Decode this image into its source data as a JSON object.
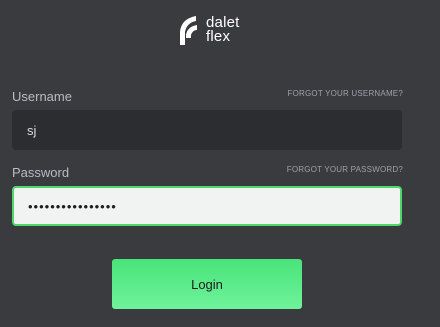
{
  "brand": {
    "line1": "dalet",
    "line2": "flex",
    "logo_icon": "dalet-flex-logo-icon",
    "color": "#ffffff"
  },
  "username": {
    "label": "Username",
    "forgot_link": "FORGOT YOUR USERNAME?",
    "value": "sj"
  },
  "password": {
    "label": "Password",
    "forgot_link": "FORGOT YOUR PASSWORD?",
    "value": "••••••••••••••••"
  },
  "login_button": {
    "label": "Login",
    "color": "#5aeb8a"
  },
  "colors": {
    "background": "#3a3b3f",
    "focus_border": "#4cd96a"
  }
}
